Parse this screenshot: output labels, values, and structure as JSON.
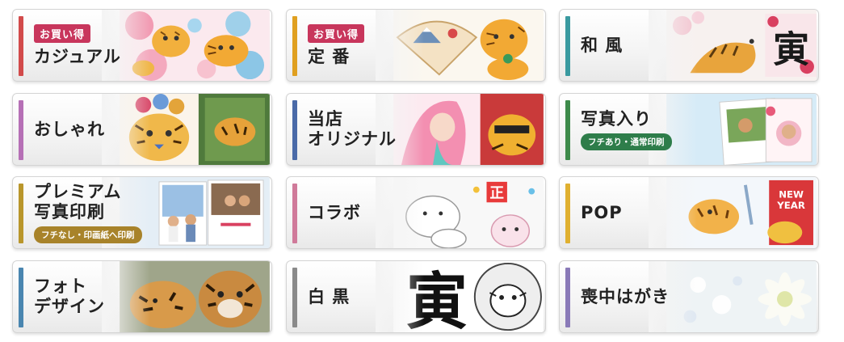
{
  "cards": [
    {
      "name": "casual",
      "badge": "お買い得",
      "title": "カジュアル",
      "bar": "#d24b4b",
      "subtitle": "",
      "art": "tigers-flowers-image"
    },
    {
      "name": "standard",
      "badge": "お買い得",
      "title": "定 番",
      "bar": "#e0a020",
      "subtitle": "",
      "art": "fan-tiger-image"
    },
    {
      "name": "japanese",
      "badge": "",
      "title": "和 風",
      "bar": "#3a9aa0",
      "subtitle": "",
      "art": "tiger-calligraphy-image"
    },
    {
      "name": "stylish",
      "badge": "",
      "title": "おしゃれ",
      "bar": "#b670b6",
      "subtitle": "",
      "art": "tiger-flowers-jungle-image"
    },
    {
      "name": "original",
      "badge": "",
      "title": "当店\nオリジナル",
      "bar": "#4a6aa8",
      "subtitle": "",
      "art": "mermaid-tiger-image"
    },
    {
      "name": "photo",
      "badge": "",
      "title": "写真入り",
      "bar": "#3d8a4a",
      "subtitle": "フチあり・通常印刷",
      "subtitle_color": "#2e7d4a",
      "art": "photo-cards-image"
    },
    {
      "name": "premium-photo",
      "badge": "",
      "title": "プレミアム\n写真印刷",
      "bar": "#b9962b",
      "subtitle": "フチなし・印画紙へ印刷",
      "subtitle_color": "#a8832a",
      "art": "family-photo-card-image"
    },
    {
      "name": "collab",
      "badge": "",
      "title": "コラボ",
      "bar": "#d07a9a",
      "subtitle": "",
      "art": "character-collab-image"
    },
    {
      "name": "pop",
      "badge": "",
      "title": "POP",
      "bar": "#e0b030",
      "subtitle": "",
      "art": "pop-tiger-new-year-image"
    },
    {
      "name": "photo-design",
      "badge": "",
      "title": "フォト\nデザイン",
      "bar": "#4a86b0",
      "subtitle": "",
      "art": "tiger-cubs-photo-image"
    },
    {
      "name": "monochrome",
      "badge": "",
      "title": "白 黒",
      "bar": "#8a8a8a",
      "subtitle": "",
      "art": "black-white-tora-image"
    },
    {
      "name": "mourning",
      "badge": "",
      "title": "喪中はがき",
      "bar": "#8a7ab8",
      "subtitle": "",
      "art": "white-flowers-image"
    }
  ],
  "art_text": {
    "tora": "寅",
    "new_year": "NEW\nYEAR",
    "sho": "正"
  }
}
